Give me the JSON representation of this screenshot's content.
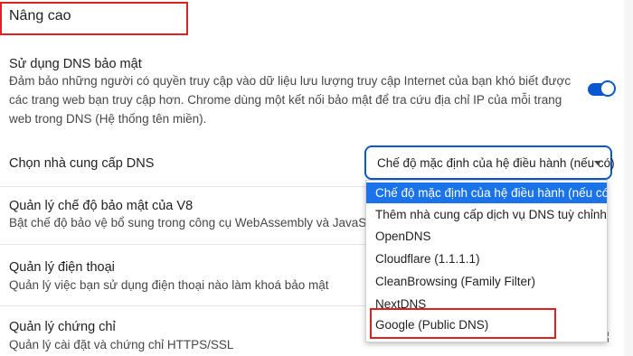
{
  "section": {
    "title": "Nâng cao"
  },
  "secure_dns": {
    "title": "Sử dụng DNS bảo mật",
    "desc_line1": "Đảm bảo những người có quyền truy cập vào dữ liệu lưu lượng truy cập Internet của bạn khó biết được",
    "desc_line2": "các trang web bạn truy cập hơn. Chrome dùng một kết nối bảo mật để tra cứu địa chỉ IP của mỗi trang",
    "desc_line3": "web trong DNS (Hệ thống tên miền).",
    "enabled": true
  },
  "provider": {
    "label": "Chọn nhà cung cấp DNS",
    "selected": "Chế độ mặc định của hệ điều hành (nếu có)",
    "options": [
      "Chế độ mặc định của hệ điều hành (nếu có)",
      "Thêm nhà cung cấp dịch vụ DNS tuỳ chỉnh",
      "OpenDNS",
      "Cloudflare (1.1.1.1)",
      "CleanBrowsing (Family Filter)",
      "NextDNS",
      "Google (Public DNS)"
    ]
  },
  "v8": {
    "title": "Quản lý chế độ bảo mật của V8",
    "desc": "Bật chế độ bảo vệ bổ sung trong công cụ WebAssembly và JavaScr"
  },
  "phone": {
    "title": "Quản lý điện thoại",
    "desc": "Quản lý việc bạn sử dụng điện thoại nào làm khoá bảo mật"
  },
  "certs": {
    "title": "Quản lý chứng chỉ",
    "desc": "Quản lý cài đặt và chứng chỉ HTTPS/SSL"
  },
  "colors": {
    "accent": "#0b57d0",
    "highlight": "#1a73e8",
    "annotation": "#e02020"
  }
}
